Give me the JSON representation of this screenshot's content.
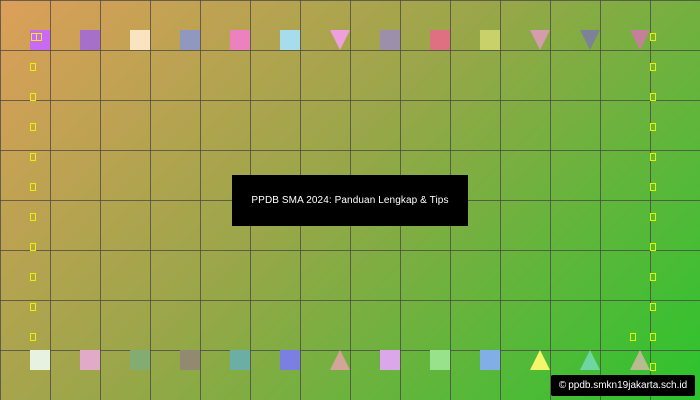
{
  "title": "PPDB SMA 2024: Panduan Lengkap & Tips",
  "credit": {
    "icon": "copyright-icon",
    "symbol": "©",
    "text": "ppdb.smkn19jakarta.sch.id"
  },
  "colors": {
    "background_start": "#dc9f5a",
    "background_end": "#2bc42e",
    "tick": "#e7f200"
  },
  "top_row": [
    {
      "shape": "square",
      "color": "#c86bf2"
    },
    {
      "shape": "square",
      "color": "#a66fc9"
    },
    {
      "shape": "square",
      "color": "#fae3c1"
    },
    {
      "shape": "square",
      "color": "#9198c0"
    },
    {
      "shape": "square",
      "color": "#ec82bd"
    },
    {
      "shape": "square",
      "color": "#a6dceb"
    },
    {
      "shape": "triangle-down",
      "color": "#eea0dc"
    },
    {
      "shape": "square",
      "color": "#9c8fac"
    },
    {
      "shape": "square",
      "color": "#de7082"
    },
    {
      "shape": "square",
      "color": "#c9d26a"
    },
    {
      "shape": "triangle-down",
      "color": "#d59cae"
    },
    {
      "shape": "triangle-down",
      "color": "#7e8299"
    },
    {
      "shape": "triangle-down",
      "color": "#c38098"
    }
  ],
  "bottom_row": [
    {
      "shape": "square",
      "color": "#e8f2e0"
    },
    {
      "shape": "square",
      "color": "#e0aac8"
    },
    {
      "shape": "square",
      "color": "#82ac72"
    },
    {
      "shape": "square",
      "color": "#918a70"
    },
    {
      "shape": "square",
      "color": "#6aaea6"
    },
    {
      "shape": "square",
      "color": "#7c7fe2"
    },
    {
      "shape": "triangle-up",
      "color": "#d4a49a"
    },
    {
      "shape": "square",
      "color": "#dca6ea"
    },
    {
      "shape": "square",
      "color": "#98e28c"
    },
    {
      "shape": "square",
      "color": "#82aee8"
    },
    {
      "shape": "triangle-up",
      "color": "#f4f66c"
    },
    {
      "shape": "triangle-up",
      "color": "#6ed6a2"
    },
    {
      "shape": "triangle-up",
      "color": "#b8ba90"
    }
  ]
}
